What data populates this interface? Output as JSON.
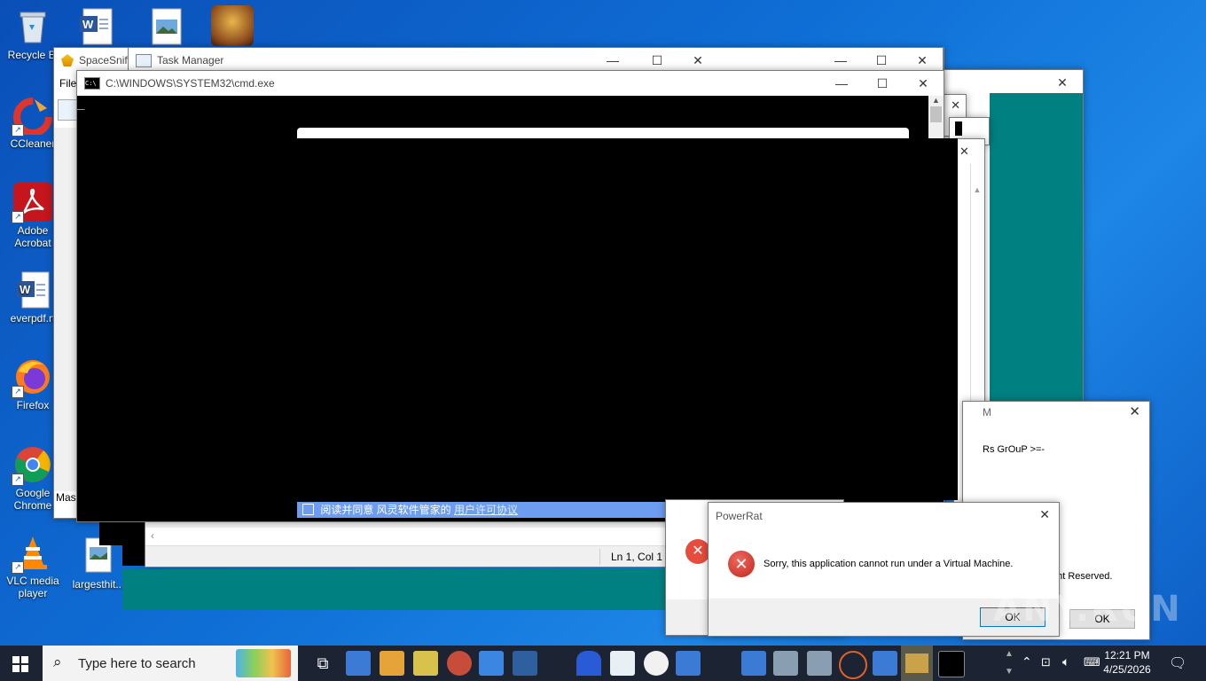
{
  "desktop": {
    "icons": [
      {
        "label": "Recycle Bin",
        "display": "Recycle Bi"
      },
      {
        "label": "CCleaner",
        "display": "CCleaner"
      },
      {
        "label": "Adobe Acrobat",
        "display": "Adobe Acrobat"
      },
      {
        "label": "everpdf.rtf",
        "display": "everpdf.rt"
      },
      {
        "label": "Firefox",
        "display": "Firefox"
      },
      {
        "label": "Google Chrome",
        "display": "Google Chrome"
      },
      {
        "label": "VLC media player",
        "display": "VLC media player"
      },
      {
        "label": "largesthit",
        "display": "largesthit..."
      }
    ]
  },
  "windows": {
    "spacesniffer": {
      "title": "SpaceSniff",
      "menu_file": "File",
      "status": "Mas"
    },
    "task_manager": {
      "title": "Task Manager"
    },
    "cmd": {
      "title": "C:\\WINDOWS\\SYSTEM32\\cmd.exe",
      "cursor": "_"
    },
    "notepad_status": {
      "position": "Ln 1, Col 1"
    },
    "chinese_bar": {
      "text": "阅读并同意 风灵软件管家的",
      "link": "用户许可协议"
    },
    "fragment_dialog": {
      "title_frag": "M",
      "line1": "Rs GrOuP >=-",
      "line2": "ght Reserved.",
      "ok": "OK"
    },
    "powerrat": {
      "title": "PowerRat",
      "message": "Sorry, this application cannot run under a Virtual Machine.",
      "ok": "OK"
    }
  },
  "taskbar": {
    "search_placeholder": "Type here to search",
    "time": "12:21 PM",
    "date": "4/25/2026"
  },
  "watermark": "ANY.RUN"
}
